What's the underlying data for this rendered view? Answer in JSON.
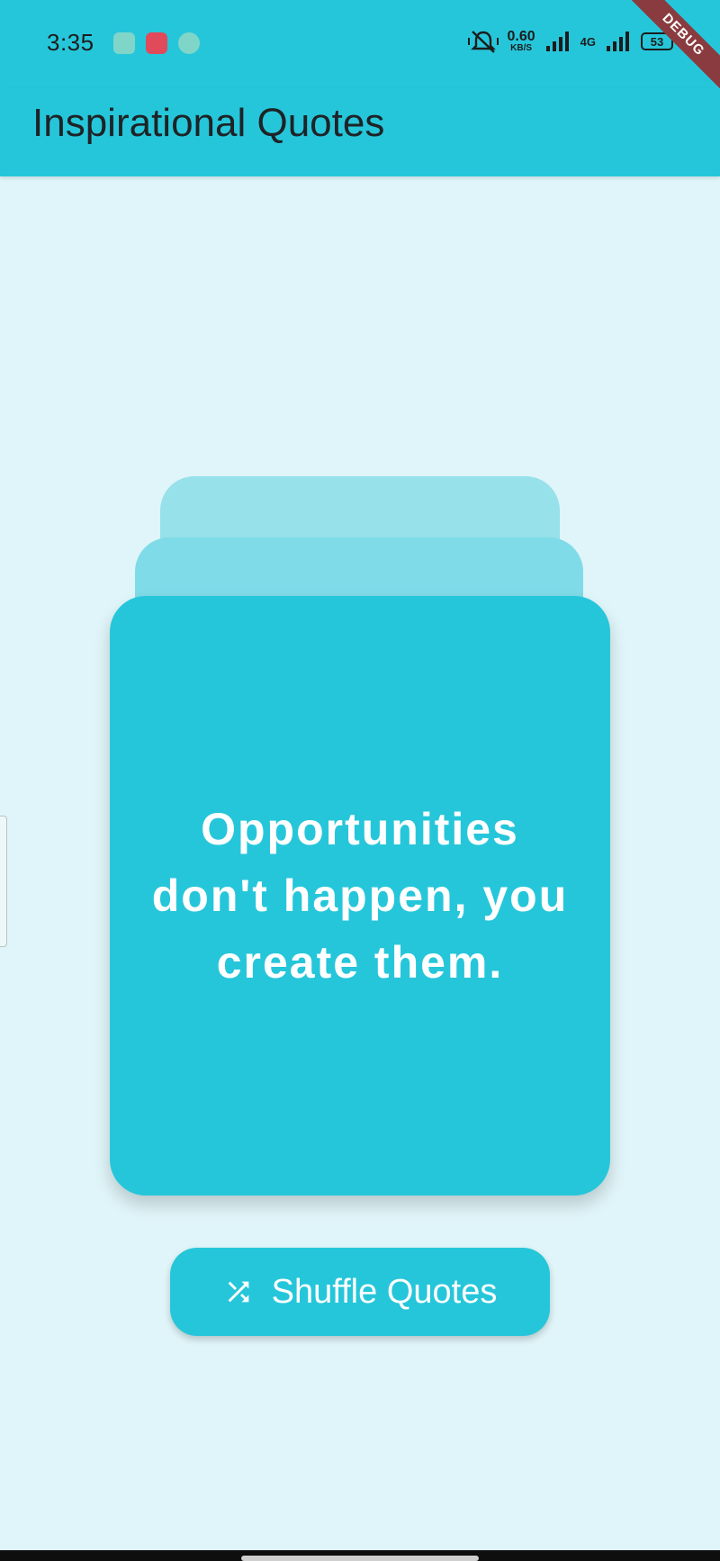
{
  "status_bar": {
    "time": "3:35",
    "net_speed_value": "0.60",
    "net_speed_unit": "KB/S",
    "network_label": "4G",
    "battery_level": "53",
    "notification_icons": [
      "gallery-app-icon",
      "screen-recorder-icon",
      "camera-app-icon"
    ]
  },
  "debug_banner": "DEBUG",
  "app_bar": {
    "title": "Inspirational Quotes"
  },
  "quote_card": {
    "text": "Opportunities don't happen, you create them."
  },
  "shuffle_button": {
    "label": "Shuffle Quotes",
    "icon": "shuffle-icon"
  },
  "colors": {
    "primary": "#26c6da",
    "background": "#e0f5f9",
    "card_back": "#96e1ea",
    "card_middle": "#7fdbe8",
    "text_on_primary": "#ffffff"
  }
}
